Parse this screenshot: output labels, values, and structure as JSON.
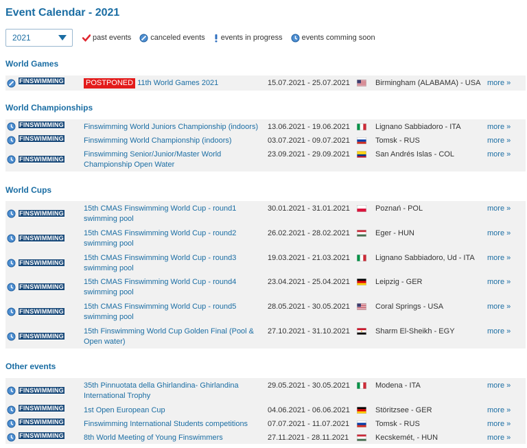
{
  "page_title": "Event Calendar - 2021",
  "year_select": {
    "value": "2021"
  },
  "legend": {
    "past": "past events",
    "canceled": "canceled events",
    "in_progress": "events in progress",
    "coming_soon": "events comming soon"
  },
  "labels": {
    "tag": "FINSWIMMING",
    "more": "more »",
    "postponed": "POSTPONED"
  },
  "colors": {
    "accent": "#1a6da3",
    "tag_bg": "#1a4a7a",
    "postponed_bg": "#e31b1b",
    "row_bg": "#f1f1f1"
  },
  "sections": [
    {
      "title": "World Games",
      "events": [
        {
          "status": "canceled",
          "postponed": true,
          "name": "11th World Games 2021",
          "dates": "15.07.2021 - 25.07.2021",
          "flag": "usa",
          "location": "Birmingham (ALABAMA) - USA"
        }
      ]
    },
    {
      "title": "World Championships",
      "events": [
        {
          "status": "coming_soon",
          "name": "Finswimming World Juniors Championship (indoors)",
          "dates": "13.06.2021 - 19.06.2021",
          "flag": "ita",
          "location": "Lignano Sabbiadoro - ITA"
        },
        {
          "status": "coming_soon",
          "name": "Finswimming World Championship (indoors)",
          "dates": "03.07.2021 - 09.07.2021",
          "flag": "rus",
          "location": "Tomsk - RUS"
        },
        {
          "status": "coming_soon",
          "name": "Finswimming Senior/Junior/Master World Championship Open Water",
          "dates": "23.09.2021 - 29.09.2021",
          "flag": "col",
          "location": "San Andrés Islas - COL"
        }
      ]
    },
    {
      "title": "World Cups",
      "events": [
        {
          "status": "coming_soon",
          "name": "15th CMAS Finswimming World Cup - round1 swimming pool",
          "dates": "30.01.2021 - 31.01.2021",
          "flag": "pol",
          "location": "Poznań - POL"
        },
        {
          "status": "coming_soon",
          "name": "15th CMAS Finswimming World Cup - round2 swimming pool",
          "dates": "26.02.2021 - 28.02.2021",
          "flag": "hun",
          "location": "Eger - HUN"
        },
        {
          "status": "coming_soon",
          "name": "15th CMAS Finswimming World Cup - round3 swimming pool",
          "dates": "19.03.2021 - 21.03.2021",
          "flag": "ita",
          "location": "Lignano Sabbiadoro, Ud - ITA"
        },
        {
          "status": "coming_soon",
          "name": "15th CMAS Finswimming World Cup - round4 swimming pool",
          "dates": "23.04.2021 - 25.04.2021",
          "flag": "ger",
          "location": "Leipzig - GER"
        },
        {
          "status": "coming_soon",
          "name": "15th CMAS Finswimming World Cup - round5 swimming pool",
          "dates": "28.05.2021 - 30.05.2021",
          "flag": "usa",
          "location": "Coral Springs - USA"
        },
        {
          "status": "coming_soon",
          "name": "15th Finswimming World Cup Golden Final (Pool & Open water)",
          "dates": "27.10.2021 - 31.10.2021",
          "flag": "egy",
          "location": "Sharm El-Sheikh - EGY"
        }
      ]
    },
    {
      "title": "Other events",
      "events": [
        {
          "status": "coming_soon",
          "name": "35th Pinnuotata della Ghirlandina- Ghirlandina International Trophy",
          "dates": "29.05.2021 - 30.05.2021",
          "flag": "ita",
          "location": "Modena - ITA"
        },
        {
          "status": "coming_soon",
          "name": "1st Open European Cup",
          "dates": "04.06.2021 - 06.06.2021",
          "flag": "ger",
          "location": "Störitzsee - GER"
        },
        {
          "status": "coming_soon",
          "name": "Finswimming International Students competitions",
          "dates": "07.07.2021 - 11.07.2021",
          "flag": "rus",
          "location": "Tomsk - RUS"
        },
        {
          "status": "coming_soon",
          "name": "8th World Meeting of Young Finswimmers",
          "dates": "27.11.2021 - 28.11.2021",
          "flag": "hun",
          "location": "Kecskemét, - HUN"
        }
      ]
    }
  ]
}
